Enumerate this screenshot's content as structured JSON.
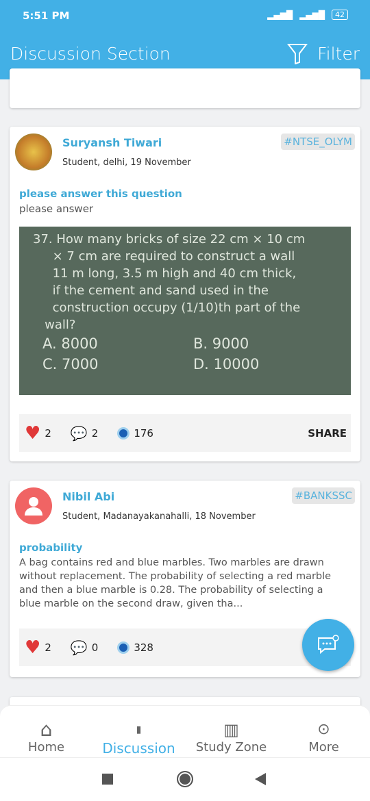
{
  "status": {
    "time": "5:51 PM",
    "battery": "42"
  },
  "header": {
    "title": "Discussion Section",
    "filter": "Filter"
  },
  "posts": [
    {
      "name": "Suryansh Tiwari",
      "meta": "Student, delhi, 19 November",
      "tag": "#NTSE_OLYM",
      "title": "please answer this question",
      "body": "please answer",
      "image_text": [
        "37.  How many bricks of size 22 cm × 10 cm",
        "     × 7 cm are required to construct a wall",
        "     11 m long, 3.5 m high and 40 cm thick,",
        "     if the cement and sand used in the",
        "     construction occupy (1/10)th part of the",
        "   wall?"
      ],
      "options": [
        "A.  8000",
        "B.  9000",
        "C.  7000",
        "D.  10000"
      ],
      "likes": "2",
      "comments": "2",
      "views": "176",
      "share": "SHARE"
    },
    {
      "name": "Nibil Abi",
      "meta": "Student, Madanayakanahalli, 18 November",
      "tag": "#BANKSSC",
      "title": "probability",
      "body": "A bag contains red and blue marbles. Two marbles are drawn without replacement. The probability of selecting a red marble and then a blue marble is 0.28. The probability of selecting a blue marble on the second draw, given tha...",
      "likes": "2",
      "comments": "0",
      "views": "328"
    }
  ],
  "nav": [
    {
      "label": "Home"
    },
    {
      "label": "Discussion"
    },
    {
      "label": "Study Zone"
    },
    {
      "label": "More"
    }
  ],
  "colors": {
    "primary": "#42b0e6",
    "like": "#e03838"
  }
}
